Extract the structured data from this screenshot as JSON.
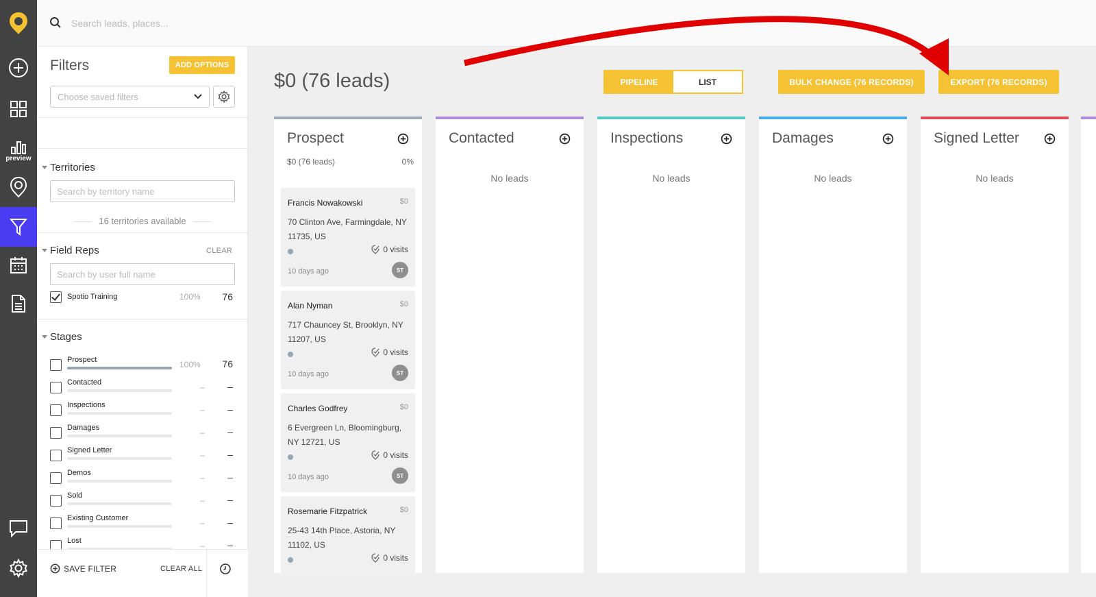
{
  "search": {
    "placeholder": "Search leads, places..."
  },
  "rail": {
    "preview_label": "preview"
  },
  "filters": {
    "title": "Filters",
    "add_options": "ADD OPTIONS",
    "saved_placeholder": "Choose saved filters",
    "territories": {
      "title": "Territories",
      "placeholder": "Search by territory name",
      "available": "16 territories available"
    },
    "field_reps": {
      "title": "Field Reps",
      "clear": "CLEAR",
      "placeholder": "Search by user full name",
      "reps": [
        {
          "name": "Spotio Training",
          "percent": "100%",
          "count": "76",
          "checked": true
        }
      ]
    },
    "stages": {
      "title": "Stages",
      "items": [
        {
          "name": "Prospect",
          "percent": "100%",
          "count": "76",
          "fill": 1.0
        },
        {
          "name": "Contacted",
          "percent": "–",
          "count": "–",
          "fill": 0
        },
        {
          "name": "Inspections",
          "percent": "–",
          "count": "–",
          "fill": 0
        },
        {
          "name": "Damages",
          "percent": "–",
          "count": "–",
          "fill": 0
        },
        {
          "name": "Signed Letter",
          "percent": "–",
          "count": "–",
          "fill": 0
        },
        {
          "name": "Demos",
          "percent": "–",
          "count": "–",
          "fill": 0
        },
        {
          "name": "Sold",
          "percent": "–",
          "count": "–",
          "fill": 0
        },
        {
          "name": "Existing Customer",
          "percent": "–",
          "count": "–",
          "fill": 0
        },
        {
          "name": "Lost",
          "percent": "–",
          "count": "–",
          "fill": 0
        }
      ]
    },
    "footer": {
      "save_filter": "SAVE FILTER",
      "clear_all": "CLEAR ALL"
    }
  },
  "main": {
    "title": "$0 (76 leads)",
    "view_toggle": {
      "pipeline": "PIPELINE",
      "list": "LIST",
      "active": "pipeline"
    },
    "bulk_change": "BULK CHANGE (76 RECORDS)",
    "export": "EXPORT (76 RECORDS)",
    "empty_label": "No leads",
    "columns": [
      {
        "title": "Prospect",
        "summary": "$0 (76 leads)",
        "percent": "0%",
        "color": "#9aabb7"
      },
      {
        "title": "Contacted",
        "color": "#a98be0"
      },
      {
        "title": "Inspections",
        "color": "#4fc9c1"
      },
      {
        "title": "Damages",
        "color": "#4aa9e8"
      },
      {
        "title": "Signed Letter",
        "color": "#e04a54"
      }
    ],
    "cards": [
      {
        "name": "Francis Nowakowski",
        "amount": "$0",
        "address": "70 Clinton Ave, Farmingdale, NY 11735, US",
        "visits": "0 visits",
        "ago": "10 days ago",
        "initials": "ST"
      },
      {
        "name": "Alan Nyman",
        "amount": "$0",
        "address": "717 Chauncey St, Brooklyn, NY 11207, US",
        "visits": "0 visits",
        "ago": "10 days ago",
        "initials": "ST"
      },
      {
        "name": "Charles Godfrey",
        "amount": "$0",
        "address": "6 Evergreen Ln, Bloomingburg, NY 12721, US",
        "visits": "0 visits",
        "ago": "10 days ago",
        "initials": "ST"
      },
      {
        "name": "Rosemarie Fitzpatrick",
        "amount": "$0",
        "address": "25-43 14th Place, Astoria, NY 11102, US",
        "visits": "0 visits"
      }
    ]
  },
  "colors": {
    "accent": "#f4c232",
    "rail": "#424242",
    "rail_active": "#4a3cf0",
    "annotation_arrow": "#e00000"
  }
}
